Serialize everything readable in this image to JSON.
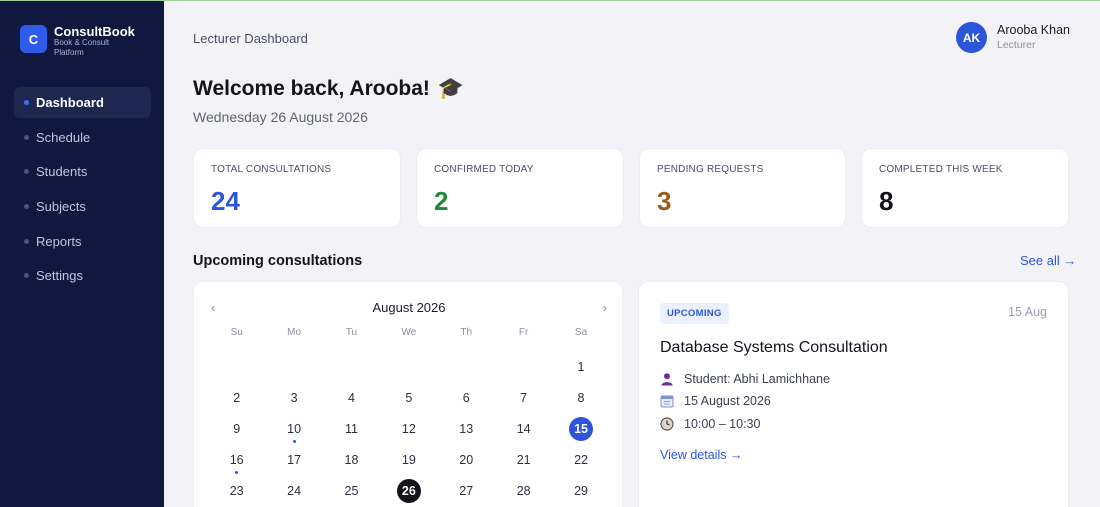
{
  "sidebar": {
    "logo_letter": "C",
    "brand_name": "ConsultBook",
    "brand_sub": "Book & Consult Platform",
    "items": [
      {
        "label": "Dashboard",
        "active": true
      },
      {
        "label": "Schedule"
      },
      {
        "label": "Students"
      },
      {
        "label": "Subjects"
      },
      {
        "label": "Reports"
      },
      {
        "label": "Settings"
      }
    ]
  },
  "header": {
    "breadcrumb": "Lecturer Dashboard",
    "user": {
      "initials": "AK",
      "name": "Arooba Khan",
      "role": "Lecturer"
    }
  },
  "welcome": {
    "title": "Welcome back, Arooba!",
    "emoji": "🎓",
    "date": "Wednesday 26 August 2026"
  },
  "stats": [
    {
      "label": "TOTAL CONSULTATIONS",
      "value": "24",
      "color": "#2d55dc"
    },
    {
      "label": "CONFIRMED TODAY",
      "value": "2",
      "color": "#1f8a3a"
    },
    {
      "label": "PENDING REQUESTS",
      "value": "3",
      "color": "#9a5b16"
    },
    {
      "label": "COMPLETED THIS WEEK",
      "value": "8",
      "color": "#12131c"
    }
  ],
  "upcoming": {
    "title": "Upcoming consultations",
    "see_all": "See all →"
  },
  "calendar": {
    "month": "August 2026",
    "prev": "‹",
    "next": "›",
    "weekdays": [
      "Su",
      "Mo",
      "Tu",
      "We",
      "Th",
      "Fr",
      "Sa"
    ],
    "weeks": [
      [
        "",
        "",
        "",
        "",
        "",
        "",
        "1"
      ],
      [
        "2",
        "3",
        "4",
        "5",
        "6",
        "7",
        "8"
      ],
      [
        "9",
        "10",
        "11",
        "12",
        "13",
        "14",
        "15"
      ],
      [
        "16",
        "17",
        "18",
        "19",
        "20",
        "21",
        "22"
      ],
      [
        "23",
        "24",
        "25",
        "26",
        "27",
        "28",
        "29"
      ]
    ],
    "selected_day": "15",
    "today": "26",
    "marked_days": [
      "10",
      "16"
    ]
  },
  "detail": {
    "badge": "UPCOMING",
    "date": "15 Aug",
    "title": "Database Systems Consultation",
    "student": "Student: Abhi Lamichhane",
    "full_date": "15 August 2026",
    "time": "10:00 – 10:30",
    "link": "View details →"
  },
  "colors": {
    "sidebar_bg": "#101840",
    "accent": "#2d55dc",
    "page_bg": "#f3f3f7"
  }
}
